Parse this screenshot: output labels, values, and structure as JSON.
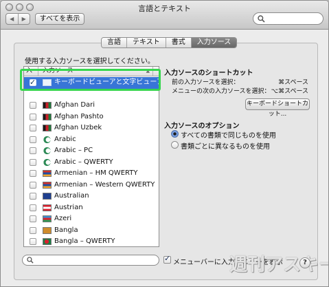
{
  "window": {
    "title": "言語とテキスト"
  },
  "toolbar": {
    "back_glyph": "◀",
    "forward_glyph": "▶",
    "show_all": "すべてを表示",
    "search_icon": "search-icon"
  },
  "tabs": [
    {
      "label": "言語",
      "active": false
    },
    {
      "label": "テキスト",
      "active": false
    },
    {
      "label": "書式",
      "active": false
    },
    {
      "label": "入力ソース",
      "active": true
    }
  ],
  "main": {
    "prompt": "使用する入力ソースを選択してください。",
    "list_headers": {
      "col1": "入",
      "col2": "入力ソース",
      "sort_glyph": "▲"
    },
    "list": [
      {
        "label": "キーボードビューアと文字ビューア",
        "checked": true,
        "selected": true,
        "icon": "viewer-icon"
      },
      {
        "label": "",
        "spacer": true
      },
      {
        "label": "Afghan Dari",
        "checked": false,
        "icon": "flag-afghanistan-icon",
        "color": "#2d2d2d"
      },
      {
        "label": "Afghan Pashto",
        "checked": false,
        "icon": "flag-afghanistan-icon",
        "color": "#2d2d2d"
      },
      {
        "label": "Afghan Uzbek",
        "checked": false,
        "icon": "flag-afghanistan-icon",
        "color": "#2d2d2d"
      },
      {
        "label": "Arabic",
        "checked": false,
        "icon": "crescent-icon",
        "color": "#2e8b57"
      },
      {
        "label": "Arabic – PC",
        "checked": false,
        "icon": "crescent-icon",
        "color": "#2e8b57"
      },
      {
        "label": "Arabic – QWERTY",
        "checked": false,
        "icon": "crescent-icon",
        "color": "#2e8b57"
      },
      {
        "label": "Armenian – HM QWERTY",
        "checked": false,
        "icon": "flag-armenia-icon",
        "color": "#d0312d"
      },
      {
        "label": "Armenian – Western QWERTY",
        "checked": false,
        "icon": "flag-armenia-icon",
        "color": "#d0312d"
      },
      {
        "label": "Australian",
        "checked": false,
        "icon": "flag-australia-icon",
        "color": "#1f3f8f"
      },
      {
        "label": "Austrian",
        "checked": false,
        "icon": "flag-austria-icon",
        "color": "#d8212f"
      },
      {
        "label": "Azeri",
        "checked": false,
        "icon": "flag-azerbaijan-icon",
        "color": "#3d8fd1"
      },
      {
        "label": "Bangla",
        "checked": false,
        "icon": "bangla-icon",
        "color": "#cf8c2c"
      },
      {
        "label": "Bangla – QWERTY",
        "checked": false,
        "icon": "flag-bangladesh-icon",
        "color": "#1b7f46"
      }
    ],
    "shortcuts": {
      "title": "入力ソースのショートカット",
      "prev_label": "前の入力ソースを選択：",
      "prev_key": "⌘スペース",
      "next_label": "メニューの次の入力ソースを選択：",
      "next_key": "⌥⌘スペース",
      "button": "キーボードショートカット..."
    },
    "options": {
      "title": "入力ソースのオプション",
      "option1": "すべての書類で同じものを使用",
      "option2": "書類ごとに異なるものを使用"
    },
    "bottom": {
      "search_placeholder": "",
      "menu_checkbox_label": "メニューバーに入力メニューを表示",
      "help_glyph": "?"
    }
  },
  "watermark": "週刊アスキー"
}
